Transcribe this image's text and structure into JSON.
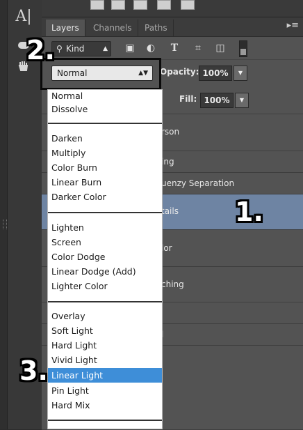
{
  "tabs": [
    {
      "label": "Layers",
      "active": true
    },
    {
      "label": "Channels",
      "active": false
    },
    {
      "label": "Paths",
      "active": false
    }
  ],
  "filter": {
    "kind_label": "Kind",
    "kind_icon": "search-icon"
  },
  "blend": {
    "selected": "Normal"
  },
  "opacity": {
    "label": "Opacity:",
    "value": "100%"
  },
  "fill": {
    "label": "Fill:",
    "value": "100%"
  },
  "layers": [
    {
      "name": "rson",
      "selected": false
    },
    {
      "name": "ing",
      "selected": false
    },
    {
      "name": "uenzy Separation",
      "selected": false
    },
    {
      "name": "tails",
      "selected": true
    },
    {
      "name": "lor",
      "selected": false
    },
    {
      "name": "ching",
      "selected": false
    },
    {
      "name": "",
      "selected": false
    },
    {
      "name": "l",
      "selected": false
    },
    {
      "name": "",
      "selected": false
    }
  ],
  "dropdown": {
    "groups": [
      [
        "Normal",
        "Dissolve"
      ],
      [
        "Darken",
        "Multiply",
        "Color Burn",
        "Linear Burn",
        "Darker Color"
      ],
      [
        "Lighten",
        "Screen",
        "Color Dodge",
        "Linear Dodge (Add)",
        "Lighter Color"
      ],
      [
        "Overlay",
        "Soft Light",
        "Hard Light",
        "Vivid Light",
        "Linear Light",
        "Pin Light",
        "Hard Mix"
      ]
    ],
    "highlighted": "Linear Light"
  },
  "steps": {
    "one": "1.",
    "two": "2.",
    "three": "3."
  },
  "colors": {
    "panel": "#535353",
    "selected_layer": "#6e84a3",
    "menu_highlight": "#3e8ed8"
  }
}
